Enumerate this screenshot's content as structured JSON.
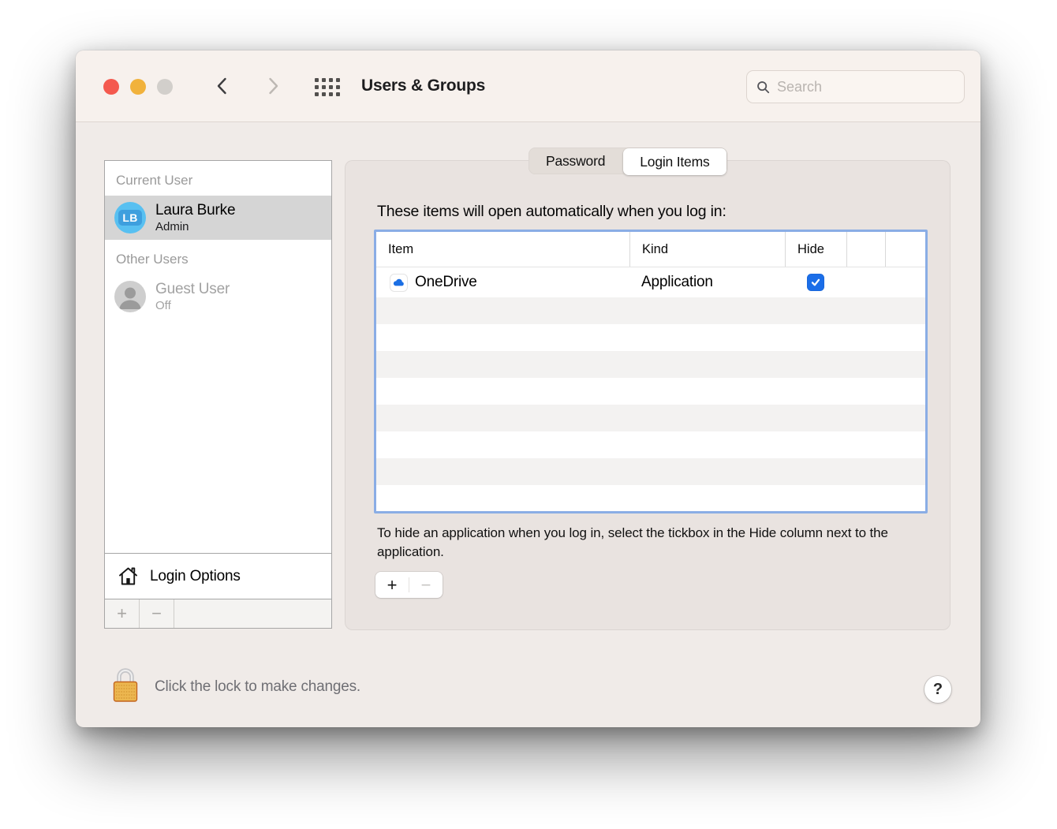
{
  "window": {
    "title": "Users & Groups",
    "search": {
      "placeholder": "Search"
    }
  },
  "sidebar": {
    "current_user_header": "Current User",
    "current_user": {
      "initials": "LB",
      "name": "Laura Burke",
      "role": "Admin"
    },
    "other_users_header": "Other Users",
    "guest_user": {
      "name": "Guest User",
      "status": "Off"
    },
    "login_options_label": "Login Options",
    "add_label": "+",
    "remove_label": "−"
  },
  "tabs": [
    {
      "label": "Password",
      "active": false
    },
    {
      "label": "Login Items",
      "active": true
    }
  ],
  "main": {
    "intro": "These items will open automatically when you log in:",
    "table": {
      "columns": [
        "Item",
        "Kind",
        "Hide"
      ],
      "rows": [
        {
          "item": "OneDrive",
          "icon": "onedrive-cloud-icon",
          "kind": "Application",
          "hide": true
        }
      ]
    },
    "hint": "To hide an application when you log in, select the tickbox in the Hide column next to the application.",
    "add_label": "+",
    "remove_label": "−"
  },
  "footer": {
    "lock_text": "Click the lock to make changes.",
    "help_label": "?"
  },
  "colors": {
    "accent_focus_ring": "#8aade5",
    "checkbox_blue": "#1b6ee8",
    "avatar_blue": "#58c0f1",
    "traffic_red": "#f4594e",
    "traffic_yellow": "#f1b23c",
    "traffic_gray": "#d2cfcb",
    "titlebar_bg": "#f7f1ed",
    "content_bg": "#f0ebe8",
    "groupbox_bg": "#e9e3e0",
    "selected_row_bg": "#d5d5d5",
    "lock_gold": "#ecb64f"
  }
}
